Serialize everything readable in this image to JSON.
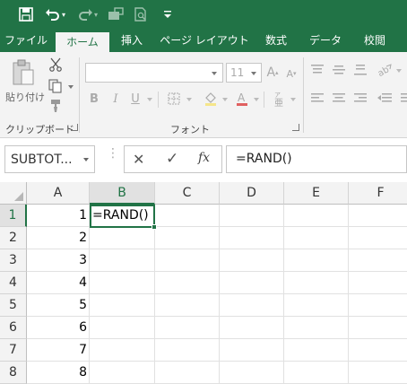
{
  "quick_access": {
    "icons": [
      "save-icon",
      "undo-icon",
      "redo-icon",
      "touch-mode-icon",
      "print-preview-icon",
      "customize-icon"
    ]
  },
  "ribbon_tabs": [
    {
      "label": "ファイル",
      "active": false
    },
    {
      "label": "ホーム",
      "active": true
    },
    {
      "label": "挿入",
      "active": false
    },
    {
      "label": "ページ レイアウト",
      "active": false
    },
    {
      "label": "数式",
      "active": false
    },
    {
      "label": "データ",
      "active": false
    },
    {
      "label": "校閲",
      "active": false
    }
  ],
  "ribbon": {
    "clipboard": {
      "paste_label": "貼り付け",
      "group_label": "クリップボード"
    },
    "font": {
      "font_name": "",
      "font_size": "11",
      "group_label": "フォント",
      "bold": "B",
      "italic": "I",
      "underline": "U"
    }
  },
  "formula_bar": {
    "name_box": "SUBTOT...",
    "cancel": "✕",
    "enter": "✓",
    "fx": "fx",
    "formula": "=RAND()"
  },
  "sheet": {
    "columns": [
      "A",
      "B",
      "C",
      "D",
      "E",
      "F"
    ],
    "selected_column": "B",
    "rows": [
      {
        "row": "1",
        "A": "1",
        "B": "=RAND()"
      },
      {
        "row": "2",
        "A": "2",
        "B": ""
      },
      {
        "row": "3",
        "A": "3",
        "B": ""
      },
      {
        "row": "4",
        "A": "4",
        "B": ""
      },
      {
        "row": "5",
        "A": "5",
        "B": ""
      },
      {
        "row": "6",
        "A": "6",
        "B": ""
      },
      {
        "row": "7",
        "A": "7",
        "B": ""
      },
      {
        "row": "8",
        "A": "8",
        "B": ""
      }
    ],
    "selected_row": "1",
    "active_cell": "B1"
  },
  "colors": {
    "brand": "#217346",
    "ribbon_bg": "#f3f3f3",
    "header_bg": "#f3f3f3",
    "gridline": "#e1e1e1"
  }
}
